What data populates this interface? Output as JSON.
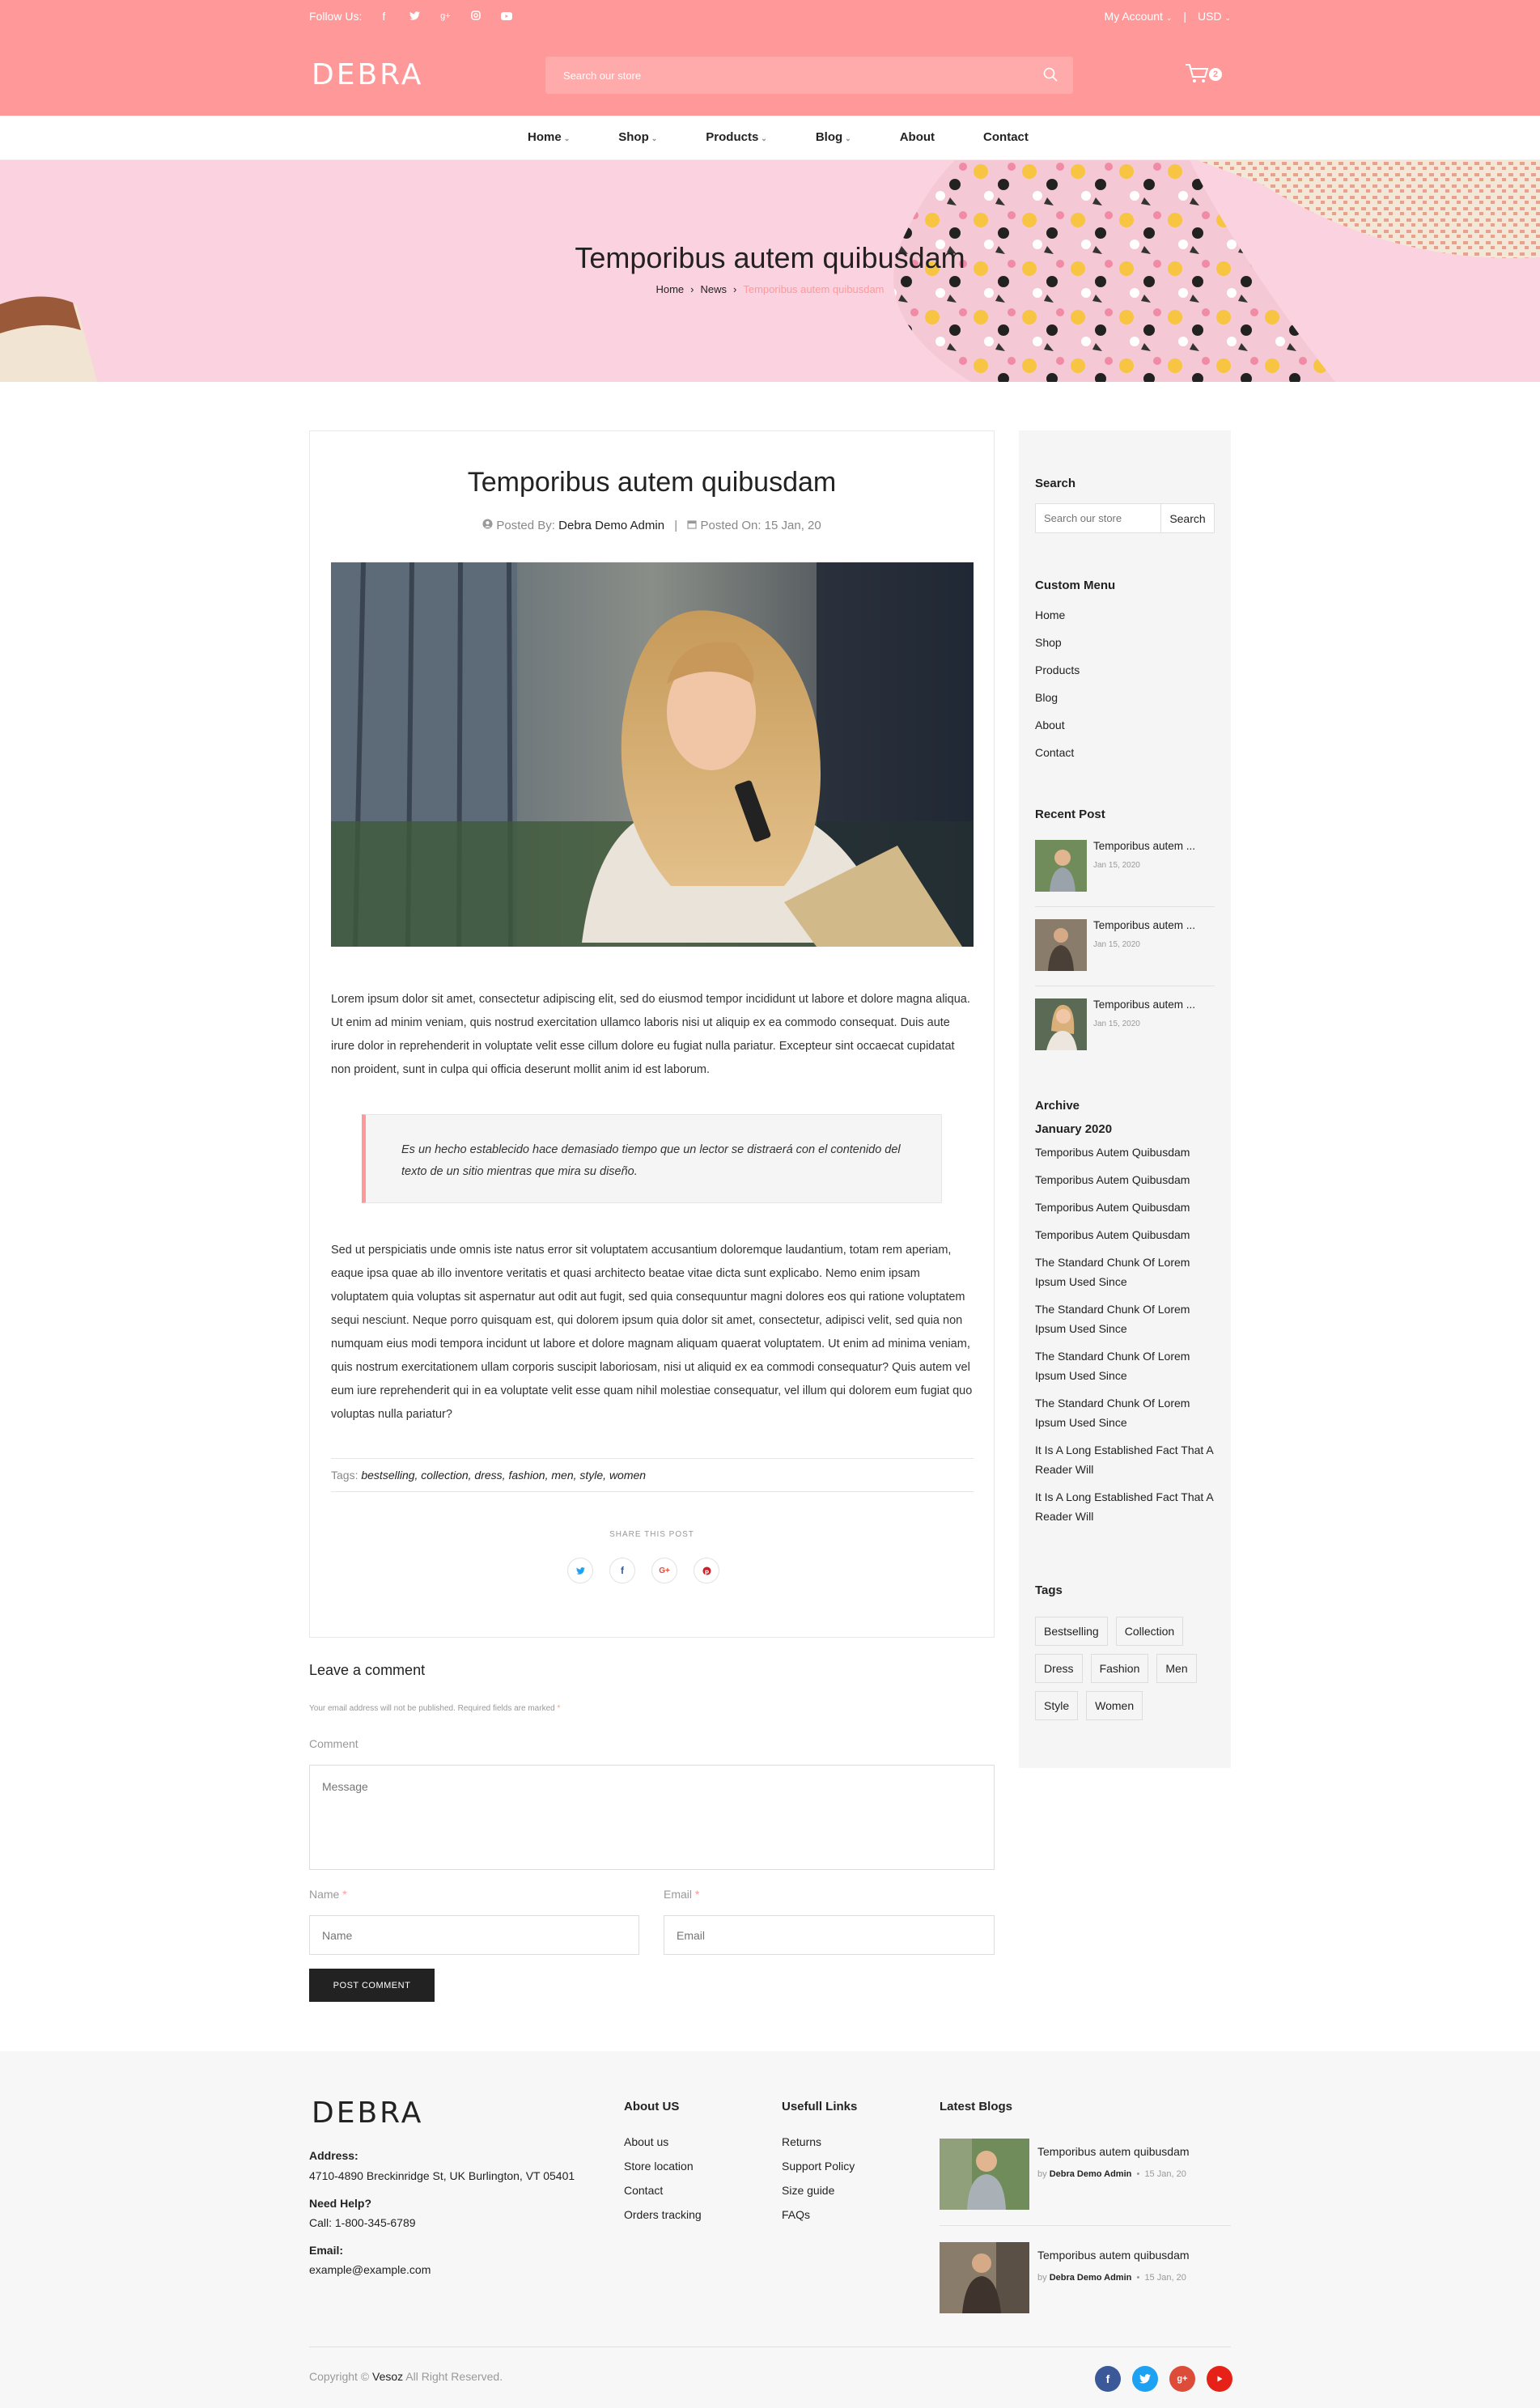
{
  "topbar": {
    "follow_label": "Follow Us:",
    "social_icons": [
      "facebook-icon",
      "twitter-icon",
      "google-plus-icon",
      "instagram-icon",
      "youtube-icon"
    ],
    "my_account": "My Account",
    "currency": "USD",
    "logo": "DEBRA",
    "search_placeholder": "Search our store",
    "cart_count": "2"
  },
  "nav": {
    "items": [
      "Home",
      "Shop",
      "Products",
      "Blog",
      "About",
      "Contact"
    ]
  },
  "banner": {
    "title": "Temporibus autem quibusdam",
    "breadcrumb": [
      "Home",
      "News",
      "Temporibus autem quibusdam"
    ]
  },
  "article": {
    "title": "Temporibus autem quibusdam",
    "posted_by_label": "Posted By:",
    "author": "Debra Demo Admin",
    "posted_on": "Posted On: 15 Jan, 20",
    "paragraph1": "Lorem ipsum dolor sit amet, consectetur adipiscing elit, sed do eiusmod tempor incididunt ut labore et dolore magna aliqua. Ut enim ad minim veniam, quis nostrud exercitation ullamco laboris nisi ut aliquip ex ea commodo consequat. Duis aute irure dolor in reprehenderit in voluptate velit esse cillum dolore eu fugiat nulla pariatur. Excepteur sint occaecat cupidatat non proident, sunt in culpa qui officia deserunt mollit anim id est laborum.",
    "quote": "Es un hecho establecido hace demasiado tiempo que un lector se distraerá con el contenido del texto de un sitio mientras que mira su diseño.",
    "paragraph2": "Sed ut perspiciatis unde omnis iste natus error sit voluptatem accusantium doloremque laudantium, totam rem aperiam, eaque ipsa quae ab illo inventore veritatis et quasi architecto beatae vitae dicta sunt explicabo. Nemo enim ipsam voluptatem quia voluptas sit aspernatur aut odit aut fugit, sed quia consequuntur magni dolores eos qui ratione voluptatem sequi nesciunt. Neque porro quisquam est, qui dolorem ipsum quia dolor sit amet, consectetur, adipisci velit, sed quia non numquam eius modi tempora incidunt ut labore et dolore magnam aliquam quaerat voluptatem. Ut enim ad minima veniam, quis nostrum exercitationem ullam corporis suscipit laboriosam, nisi ut aliquid ex ea commodi consequatur? Quis autem vel eum iure reprehenderit qui in ea voluptate velit esse quam nihil molestiae consequatur, vel illum qui dolorem eum fugiat quo voluptas nulla pariatur?",
    "tags_label": "Tags:",
    "tags": "bestselling, collection, dress, fashion, men, style, women",
    "share_label": "SHARE THIS POST"
  },
  "comment_form": {
    "title": "Leave a comment",
    "note": "Your email address will not be published. Required fields are marked",
    "comment_label": "Comment",
    "message_placeholder": "Message",
    "name_label": "Name",
    "name_placeholder": "Name",
    "email_label": "Email",
    "email_placeholder": "Email",
    "submit": "POST COMMENT"
  },
  "sidebar": {
    "search_title": "Search",
    "search_placeholder": "Search our store",
    "search_button": "Search",
    "menu_title": "Custom Menu",
    "menu": [
      "Home",
      "Shop",
      "Products",
      "Blog",
      "About",
      "Contact"
    ],
    "recent_title": "Recent Post",
    "recent": [
      {
        "title": "Temporibus autem ...",
        "date": "Jan 15, 2020"
      },
      {
        "title": "Temporibus autem ...",
        "date": "Jan 15, 2020"
      },
      {
        "title": "Temporibus autem ...",
        "date": "Jan 15, 2020"
      }
    ],
    "archive_title": "Archive",
    "archive_month": "January 2020",
    "archive": [
      "Temporibus Autem Quibusdam",
      "Temporibus Autem Quibusdam",
      "Temporibus Autem Quibusdam",
      "Temporibus Autem Quibusdam",
      "The Standard Chunk Of Lorem Ipsum Used Since",
      "The Standard Chunk Of Lorem Ipsum Used Since",
      "The Standard Chunk Of Lorem Ipsum Used Since",
      "The Standard Chunk Of Lorem Ipsum Used Since",
      "It Is A Long Established Fact That A Reader Will",
      "It Is A Long Established Fact That A Reader Will"
    ],
    "tags_title": "Tags",
    "tags": [
      "Bestselling",
      "Collection",
      "Dress",
      "Fashion",
      "Men",
      "Style",
      "Women"
    ]
  },
  "footer": {
    "logo": "DEBRA",
    "address_label": "Address:",
    "address": "4710-4890 Breckinridge St, UK Burlington, VT 05401",
    "help_label": "Need Help?",
    "help": "Call: 1-800-345-6789",
    "email_label": "Email:",
    "email": "example@example.com",
    "about_title": "About US",
    "about_links": [
      "About us",
      "Store location",
      "Contact",
      "Orders tracking"
    ],
    "useful_title": "Usefull Links",
    "useful_links": [
      "Returns",
      "Support Policy",
      "Size guide",
      "FAQs"
    ],
    "blogs_title": "Latest Blogs",
    "blogs": [
      {
        "title": "Temporibus autem quibusdam",
        "by": "by",
        "author": "Debra Demo Admin",
        "date": "15 Jan, 20"
      },
      {
        "title": "Temporibus autem quibusdam",
        "by": "by",
        "author": "Debra Demo Admin",
        "date": "15 Jan, 20"
      }
    ],
    "copyright_prefix": "Copyright ©",
    "brand": "Vesoz",
    "copyright_suffix": "All Right Reserved."
  },
  "colors": {
    "brand": "#ff9999",
    "dark": "#222222",
    "facebook": "#3b5998",
    "twitter": "#1da1f2",
    "google": "#dd4b39",
    "youtube": "#e62117"
  }
}
